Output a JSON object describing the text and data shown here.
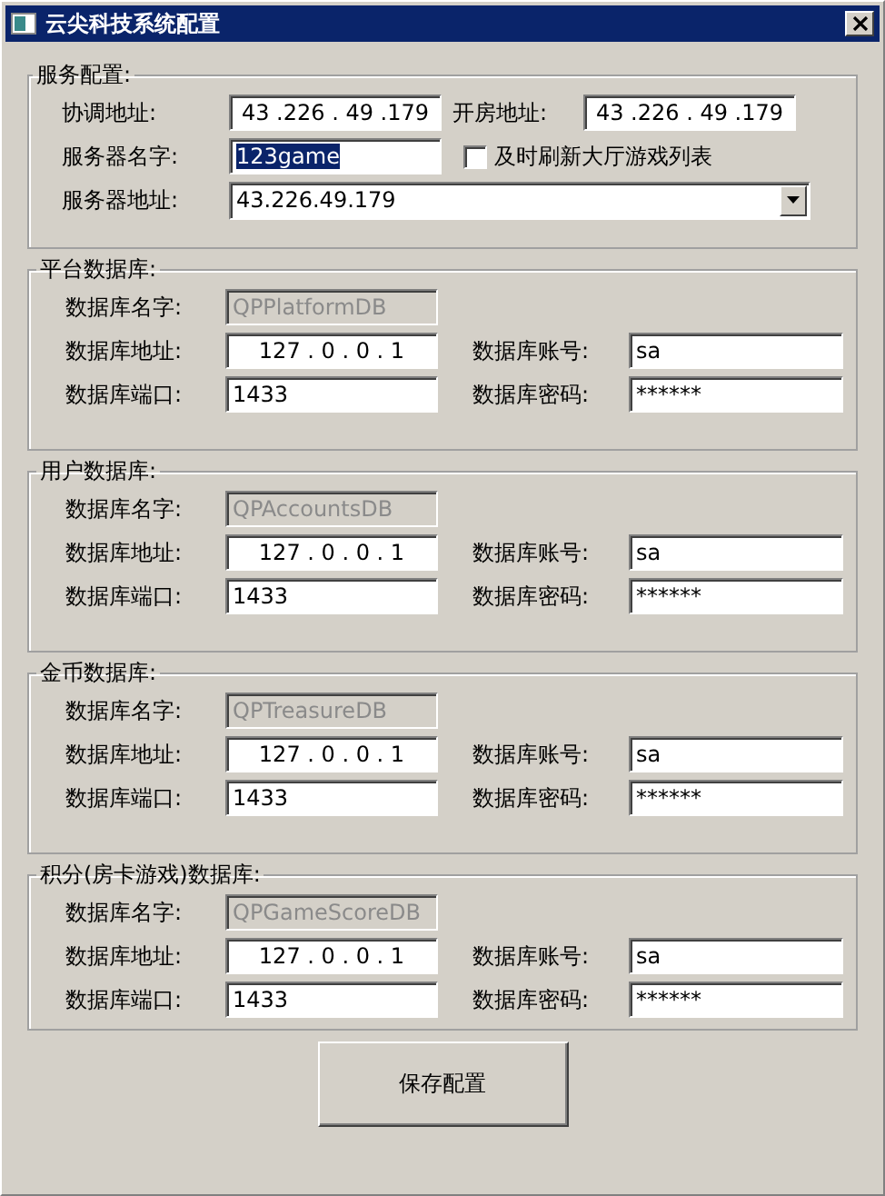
{
  "window": {
    "title": "云尖科技系统配置"
  },
  "service": {
    "legend": "服务配置:",
    "coord": {
      "label": "协调地址:",
      "value": "43 .226 . 49 .179"
    },
    "room": {
      "label": "开房地址:",
      "value": "43 .226 . 49 .179"
    },
    "name": {
      "label": "服务器名字:",
      "value": "123game",
      "selected": true
    },
    "refresh": {
      "label": "及时刷新大厅游戏列表",
      "checked": false
    },
    "address": {
      "label": "服务器地址:",
      "value": "43.226.49.179"
    }
  },
  "databases": [
    {
      "legend": "平台数据库:",
      "name": {
        "label": "数据库名字:",
        "value": "QPPlatformDB",
        "disabled": true
      },
      "address": {
        "label": "数据库地址:",
        "value": "127 . 0 . 0 . 1"
      },
      "account": {
        "label": "数据库账号:",
        "value": "sa"
      },
      "port": {
        "label": "数据库端口:",
        "value": "1433"
      },
      "password": {
        "label": "数据库密码:",
        "value": "******"
      }
    },
    {
      "legend": "用户数据库:",
      "name": {
        "label": "数据库名字:",
        "value": "QPAccountsDB",
        "disabled": true
      },
      "address": {
        "label": "数据库地址:",
        "value": "127 . 0 . 0 . 1"
      },
      "account": {
        "label": "数据库账号:",
        "value": "sa"
      },
      "port": {
        "label": "数据库端口:",
        "value": "1433"
      },
      "password": {
        "label": "数据库密码:",
        "value": "******"
      }
    },
    {
      "legend": "金币数据库:",
      "name": {
        "label": "数据库名字:",
        "value": "QPTreasureDB",
        "disabled": true
      },
      "address": {
        "label": "数据库地址:",
        "value": "127 . 0 . 0 . 1"
      },
      "account": {
        "label": "数据库账号:",
        "value": "sa"
      },
      "port": {
        "label": "数据库端口:",
        "value": "1433"
      },
      "password": {
        "label": "数据库密码:",
        "value": "******"
      }
    },
    {
      "legend": "积分(房卡游戏)数据库:",
      "name": {
        "label": "数据库名字:",
        "value": "QPGameScoreDB",
        "disabled": true
      },
      "address": {
        "label": "数据库地址:",
        "value": "127 . 0 . 0 . 1"
      },
      "account": {
        "label": "数据库账号:",
        "value": "sa"
      },
      "port": {
        "label": "数据库端口:",
        "value": "1433"
      },
      "password": {
        "label": "数据库密码:",
        "value": "******"
      }
    }
  ],
  "save_button": {
    "label": "保存配置"
  }
}
